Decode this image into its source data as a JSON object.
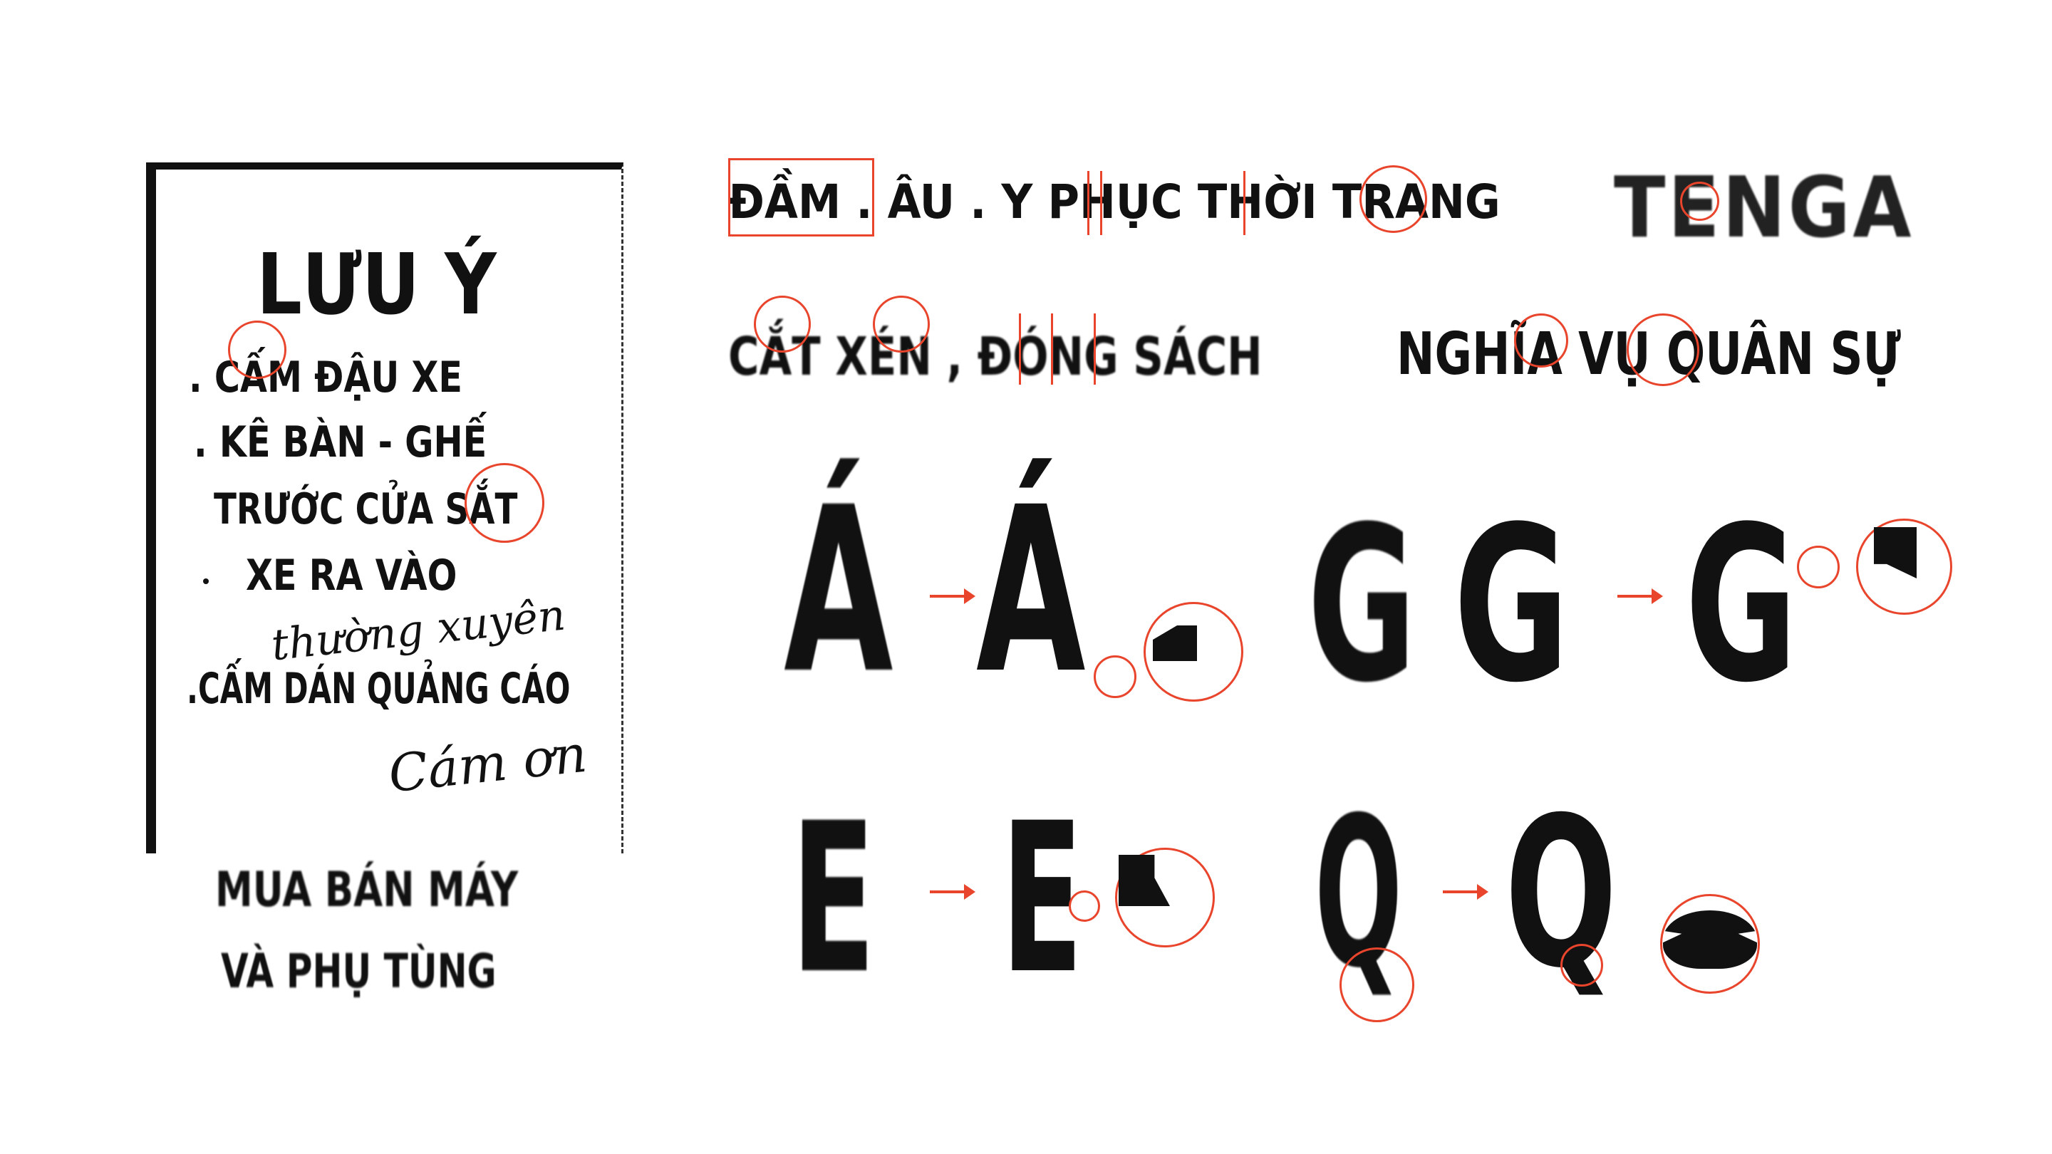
{
  "notice": {
    "title": "LƯU Ý",
    "line1": ". CẤM ĐẬU XE",
    "line2": ". KÊ BÀN - GHẾ",
    "line3": "TRƯỚC CỬA SẮT",
    "line4": "XE RA VÀO",
    "line5": "thường xuyên",
    "line6": ".CẤM DÁN QUẢNG CÁO",
    "line7": "Cám ơn",
    "sub1": "MUA BÁN MÁY",
    "sub2": "VÀ PHỤ TÙNG"
  },
  "samples": {
    "sign1": "ĐẦM . ÂU . Y PHỤC THỜI TRANG",
    "sign2": "TENGA",
    "sign3": "CẮT XÉN , ĐÓNG SÁCH",
    "sign4": "NGHĨA VỤ QUÂN SỰ"
  },
  "glyphs": {
    "a_acute_orig": "Á",
    "a_acute_new": "Á",
    "g_orig": "G",
    "g_pixel": "G",
    "g_new": "G",
    "e_orig": "E",
    "e_new": "E",
    "q_orig": "Q",
    "q_new": "Q"
  },
  "colors": {
    "accent": "#e8452c",
    "ink": "#111111",
    "paper": "#ffffff"
  }
}
